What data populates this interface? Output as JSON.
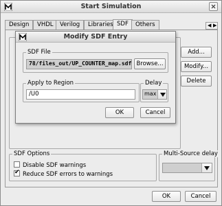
{
  "window": {
    "title": "Start Simulation"
  },
  "tabs": [
    {
      "label": "Design"
    },
    {
      "label": "VHDL"
    },
    {
      "label": "Verilog"
    },
    {
      "label": "Libraries"
    },
    {
      "label": "SDF"
    },
    {
      "label": "Others"
    }
  ],
  "active_tab": "SDF",
  "side_buttons": {
    "add": "Add...",
    "modify": "Modify...",
    "delete": "Delete"
  },
  "sdf_options": {
    "title": "SDF Options",
    "disable_warnings": {
      "label": "Disable SDF warnings",
      "checked": false
    },
    "reduce_errors": {
      "label": "Reduce SDF errors to warnings",
      "checked": true
    }
  },
  "multi_source": {
    "title": "Multi-Source delay",
    "value": ""
  },
  "footer": {
    "ok": "OK",
    "cancel": "Cancel"
  },
  "modal": {
    "title": "Modify SDF Entry",
    "sdf_file": {
      "label": "SDF File",
      "value": "78/files_out/UP_COUNTER_map.sdf",
      "browse": "Browse..."
    },
    "region": {
      "label": "Apply to Region",
      "value": "/U0"
    },
    "delay": {
      "label": "Delay",
      "value": "max"
    },
    "ok": "OK",
    "cancel": "Cancel"
  },
  "colors": {
    "readonly_field": "#cfcfcf",
    "window_bg": "#ececec"
  }
}
